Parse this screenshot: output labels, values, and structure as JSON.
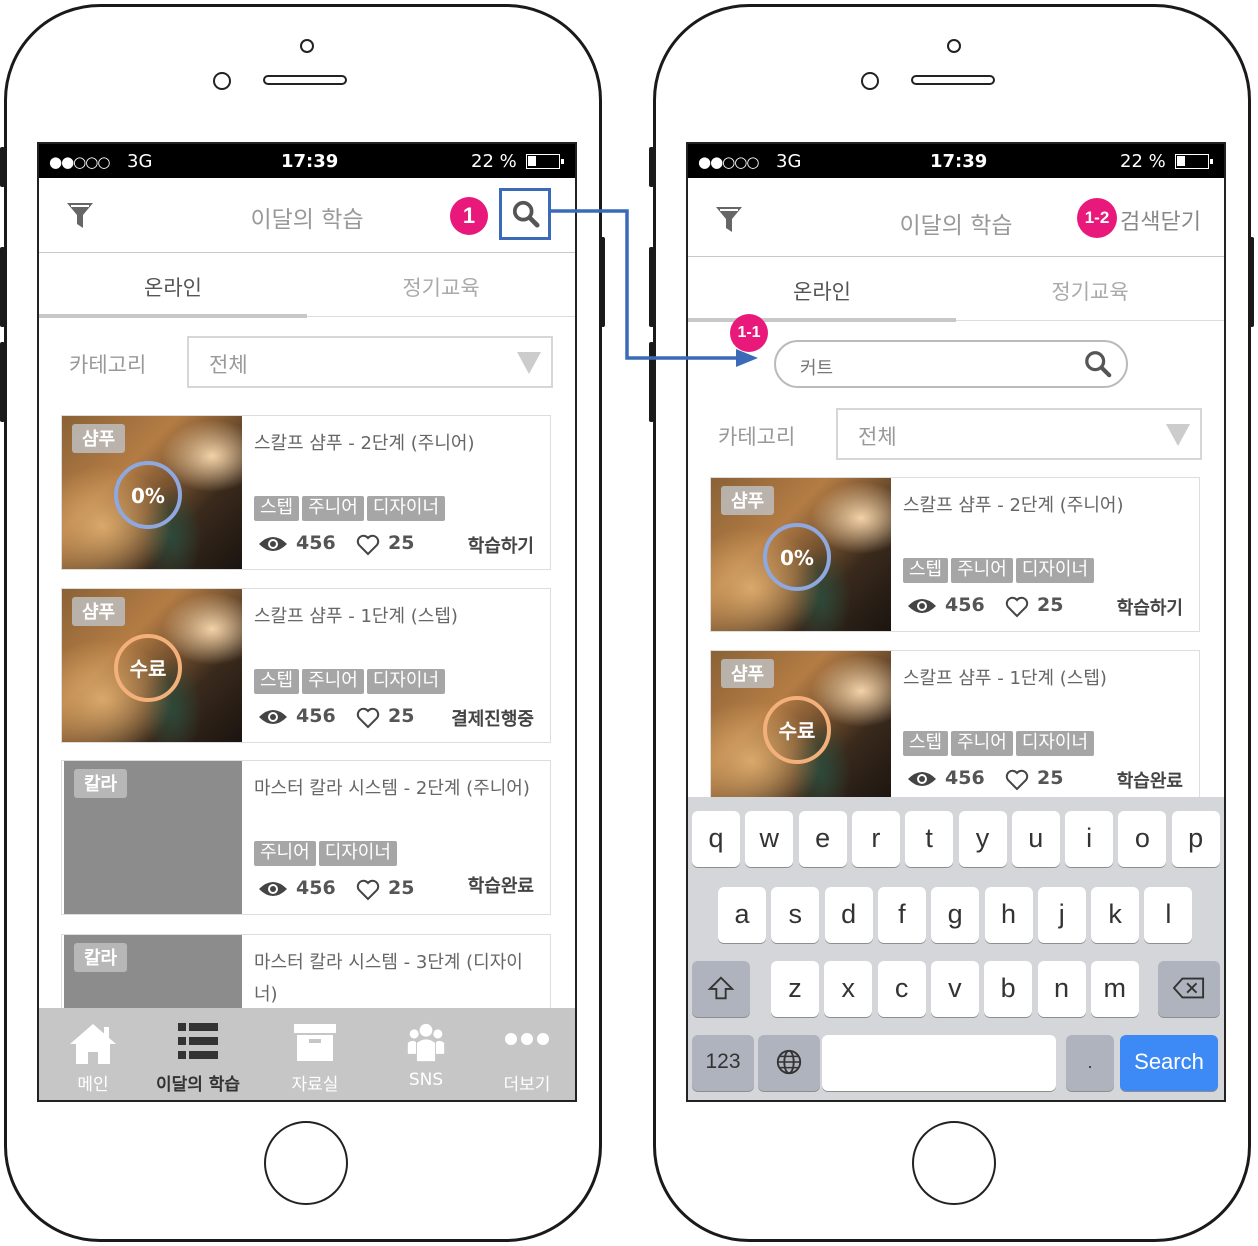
{
  "status_bar": {
    "signal": "●●○○○",
    "network": "3G",
    "time": "17:39",
    "battery": "22 %"
  },
  "header": {
    "title": "이달의 학습",
    "close_search": "검색닫기"
  },
  "tabs": [
    {
      "label": "온라인"
    },
    {
      "label": "정기교육"
    }
  ],
  "category": {
    "label": "카테고리",
    "value": "전체"
  },
  "search": {
    "value": "커트"
  },
  "callouts": {
    "c1": "1",
    "c11": "1-1",
    "c12": "1-2"
  },
  "cards": [
    {
      "tag": "샴푸",
      "title": "스칼프 샴푸 - 2단계 (주니어)",
      "progress": "0%",
      "badges": [
        "스텝",
        "주니어",
        "디자이너"
      ],
      "views": "456",
      "likes": "25",
      "action": "학습하기"
    },
    {
      "tag": "샴푸",
      "title": "스칼프 샴푸 - 1단계 (스텝)",
      "progress": "수료",
      "badges": [
        "스텝",
        "주니어",
        "디자이너"
      ],
      "views": "456",
      "likes": "25",
      "action": "결제진행중",
      "action_right": "학습완료"
    },
    {
      "tag": "칼라",
      "title": "마스터 칼라 시스템 - 2단계 (주니어)",
      "badges": [
        "주니어",
        "디자이너"
      ],
      "views": "456",
      "likes": "25",
      "action": "학습완료"
    },
    {
      "tag": "칼라",
      "title": "마스터 칼라 시스템 - 3단계 (디자이너)"
    }
  ],
  "bottom_nav": [
    {
      "label": "메인",
      "icon": "home-icon"
    },
    {
      "label": "이달의 학습",
      "icon": "list-icon",
      "active": true
    },
    {
      "label": "자료실",
      "icon": "archive-icon"
    },
    {
      "label": "SNS",
      "icon": "people-icon"
    },
    {
      "label": "더보기",
      "icon": "more-icon"
    }
  ],
  "keyboard": {
    "row1": [
      "q",
      "w",
      "e",
      "r",
      "t",
      "y",
      "u",
      "i",
      "o",
      "p"
    ],
    "row2": [
      "a",
      "s",
      "d",
      "f",
      "g",
      "h",
      "j",
      "k",
      "l"
    ],
    "row3": [
      "z",
      "x",
      "c",
      "v",
      "b",
      "n",
      "m"
    ],
    "numbers": "123",
    "period": ".",
    "search": "Search"
  },
  "colors": {
    "callout": "#e8197a",
    "highlight_border": "#3a6ab8",
    "search_key": "#3d8af7",
    "progress_blue": "#8fa8e0",
    "progress_orange": "#f3b07a"
  }
}
